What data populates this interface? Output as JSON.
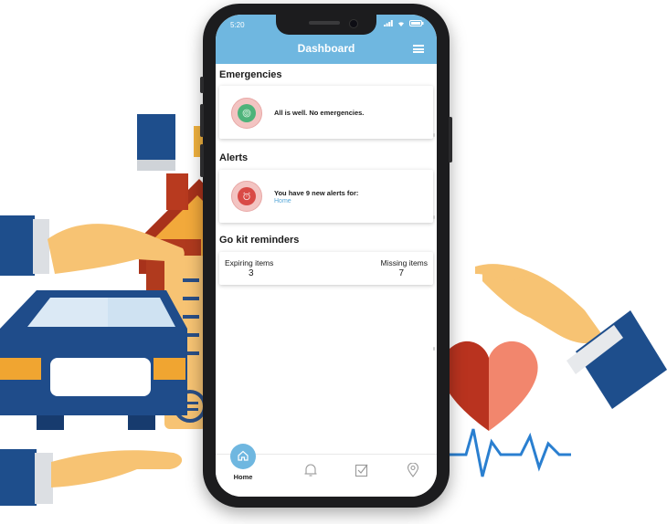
{
  "status_bar": {
    "time": "5:20"
  },
  "app_bar": {
    "title": "Dashboard",
    "menu_icon": "hamburger-menu-icon"
  },
  "emergencies": {
    "title": "Emergencies",
    "message": "All is well. No emergencies.",
    "icon": "fingerprint-icon",
    "status_color": "#4db37a"
  },
  "alerts": {
    "title": "Alerts",
    "message": "You have 9 new alerts for:",
    "link": "Home",
    "icon": "alarm-clock-icon",
    "status_color": "#d94a46"
  },
  "go_kit": {
    "title": "Go kit reminders",
    "expiring_label": "Expiring items",
    "expiring_value": "3",
    "missing_label": "Missing items",
    "missing_value": "7"
  },
  "tab_bar": {
    "items": [
      {
        "label": "Home",
        "icon": "home-icon",
        "active": true
      },
      {
        "icon": "bell-icon"
      },
      {
        "icon": "checkbox-icon"
      },
      {
        "icon": "location-pin-icon"
      }
    ]
  },
  "colors": {
    "accent": "#6fb7e0",
    "danger": "#d94a46",
    "ok": "#4db37a"
  }
}
